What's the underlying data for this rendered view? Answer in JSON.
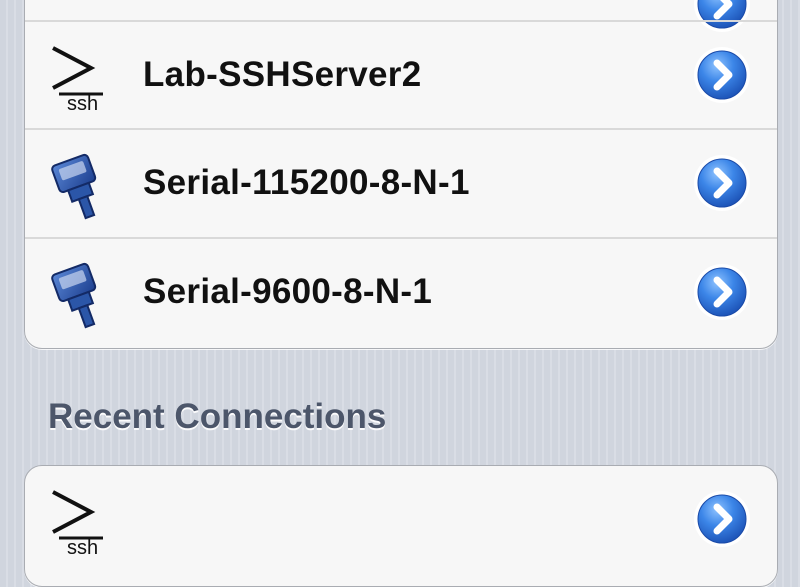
{
  "favorites": {
    "items": [
      {
        "label": "",
        "icon": "ssh-terminal-icon"
      },
      {
        "label": "Lab-SSHServer2",
        "icon": "ssh-terminal-icon"
      },
      {
        "label": "Serial-115200-8-N-1",
        "icon": "serial-cable-icon"
      },
      {
        "label": "Serial-9600-8-N-1",
        "icon": "serial-cable-icon"
      }
    ]
  },
  "recent": {
    "header": "Recent Connections",
    "items": [
      {
        "label": "",
        "icon": "ssh-terminal-icon"
      }
    ]
  },
  "colors": {
    "background": "#d3d8e1",
    "section_header": "#4c566a",
    "disclosure_blue": "#2a6fd6",
    "cell_background": "#f7f7f7"
  }
}
